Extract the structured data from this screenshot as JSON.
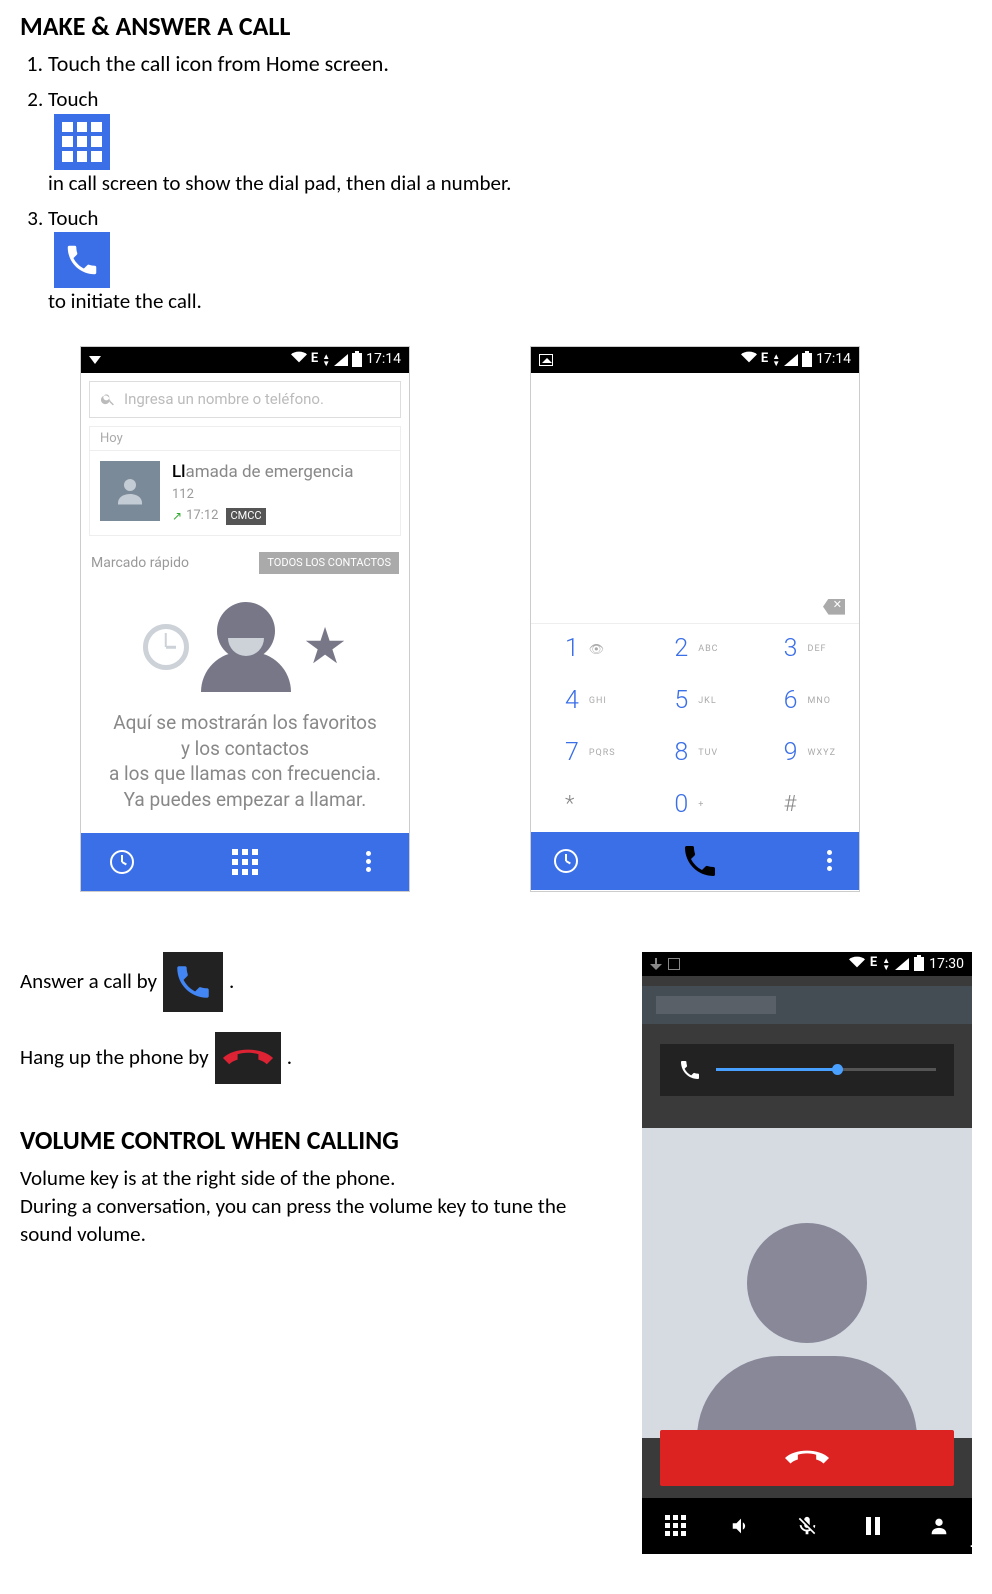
{
  "h1": "MAKE & ANSWER A CALL",
  "steps": {
    "s1": "Touch the call icon from Home screen.",
    "s2a": "Touch",
    "s2b": "in call screen to show the dial pad, then dial a number.",
    "s3a": "Touch",
    "s3b": " to initiate the call."
  },
  "shot1": {
    "time": "17:14",
    "edge": "E",
    "search_placeholder": "Ingresa un nombre o teléfono.",
    "today": "Hoy",
    "recent_title": "Llamada de emergencia",
    "recent_num": "112",
    "recent_time": "17:12",
    "recent_carrier": "CMCC",
    "speed": "Marcado rápido",
    "all_contacts": "TODOS LOS CONTACTOS",
    "favs1": "Aquí se mostrarán los favoritos",
    "favs2": "y los contactos",
    "favs3": "a los que llamas con frecuencia.",
    "favs4": "Ya puedes empezar a llamar."
  },
  "shot2": {
    "time": "17:14",
    "edge": "E",
    "keys": [
      {
        "n": "1",
        "l": ""
      },
      {
        "n": "2",
        "l": "ABC"
      },
      {
        "n": "3",
        "l": "DEF"
      },
      {
        "n": "4",
        "l": "GHI"
      },
      {
        "n": "5",
        "l": "JKL"
      },
      {
        "n": "6",
        "l": "MNO"
      },
      {
        "n": "7",
        "l": "PQRS"
      },
      {
        "n": "8",
        "l": "TUV"
      },
      {
        "n": "9",
        "l": "WXYZ"
      },
      {
        "n": "*",
        "l": ""
      },
      {
        "n": "0",
        "l": "+"
      },
      {
        "n": "#",
        "l": ""
      }
    ]
  },
  "answer_line_a": "Answer a call by ",
  "answer_line_b": ".",
  "hang_line_a": "Hang up the phone by ",
  "hang_line_b": ".",
  "h2": "VOLUME CONTROL WHEN CALLING",
  "vol_p1": "Volume key is at the right side of the phone.",
  "vol_p2": "During a conversation, you can press the volume key to tune the sound volume.",
  "shot3": {
    "time": "17:30",
    "edge": "E"
  }
}
